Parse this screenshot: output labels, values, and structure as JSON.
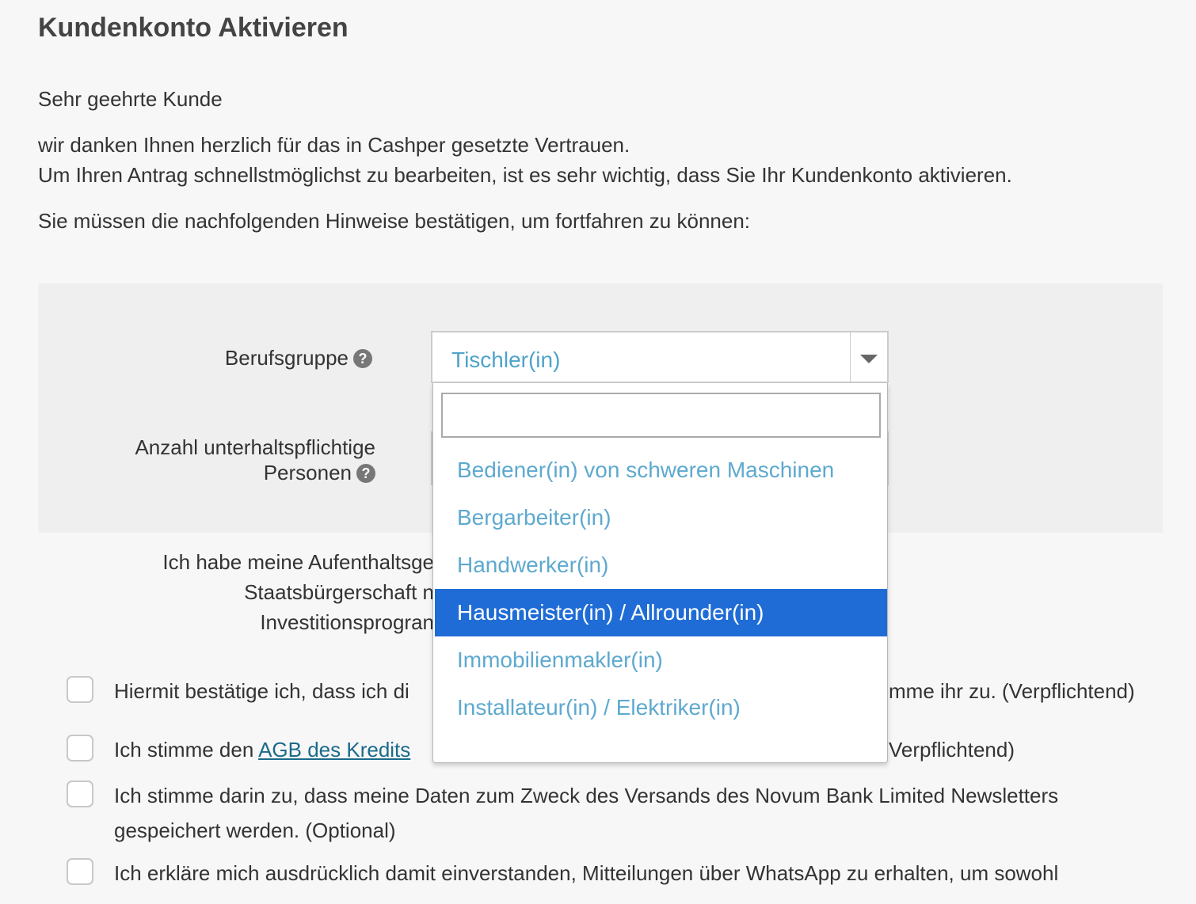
{
  "page": {
    "title": "Kundenkonto Aktivieren",
    "greeting": "Sehr geehrte Kunde",
    "intro_line1": "wir danken Ihnen herzlich für das in Cashper gesetzte Vertrauen.",
    "intro_line2": "Um Ihren Antrag schnellstmöglichst zu bearbeiten, ist es sehr wichtig, dass Sie Ihr Kundenkonto aktivieren.",
    "instructions": "Sie müssen die nachfolgenden Hinweise bestätigen, um fortfahren zu können:"
  },
  "form": {
    "berufsgruppe_label": "Berufsgruppe",
    "berufsgruppe_value": "Tischler(in)",
    "dependents_label_line1": "Anzahl unterhaltspflichtige",
    "dependents_label_line2": "Personen",
    "help_glyph": "?",
    "residence_line1": "Ich habe meine Aufenthaltsge",
    "residence_line2": "Staatsbürgerschaft n",
    "residence_line3": "Investitionsprogran"
  },
  "dropdown": {
    "search_value": "",
    "options": [
      "Bediener(in) von schweren Maschinen",
      "Bergarbeiter(in)",
      "Handwerker(in)",
      "Hausmeister(in) / Allrounder(in)",
      "Immobilienmakler(in)",
      "Installateur(in) / Elektriker(in)"
    ],
    "selected_index": 3
  },
  "consents": {
    "c1_left": "Hiermit bestätige ich, dass ich di",
    "c1_right": "mme ihr zu. (Verpflichtend)",
    "c2_prefix": "Ich stimme den ",
    "c2_link": "AGB des Kredits",
    "c2_right": "Verpflichtend)",
    "c3_line1": "Ich stimme darin zu, dass meine Daten zum Zweck des Versands des Novum Bank Limited Newsletters",
    "c3_line2": "gespeichert werden. (Optional)",
    "c4_line1": "Ich erkläre mich ausdrücklich damit einverstanden, Mitteilungen über WhatsApp zu erhalten, um sowohl"
  },
  "colors": {
    "accent": "#5ea9cf",
    "selected_bg": "#1f6cd6",
    "link": "#1a6b8a"
  }
}
